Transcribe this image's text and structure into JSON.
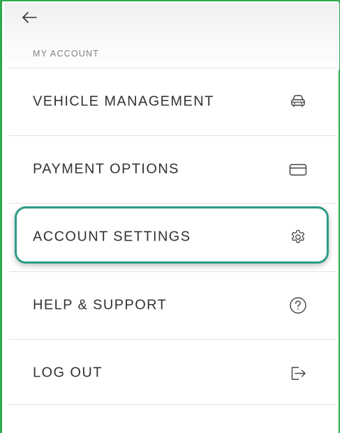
{
  "header": {
    "back_icon": "arrow-left-icon",
    "section_title": "MY ACCOUNT"
  },
  "menu": {
    "items": [
      {
        "label": "VEHICLE MANAGEMENT",
        "icon": "car-icon"
      },
      {
        "label": "PAYMENT OPTIONS",
        "icon": "credit-card-icon"
      },
      {
        "label": "ACCOUNT SETTINGS",
        "icon": "gear-icon",
        "highlighted": true
      },
      {
        "label": "HELP & SUPPORT",
        "icon": "help-circle-icon"
      },
      {
        "label": "LOG OUT",
        "icon": "logout-icon"
      }
    ]
  },
  "colors": {
    "frame_border": "#2ea84a",
    "highlight_border": "#2a9b86",
    "text": "#333333",
    "section_label": "#808080"
  }
}
